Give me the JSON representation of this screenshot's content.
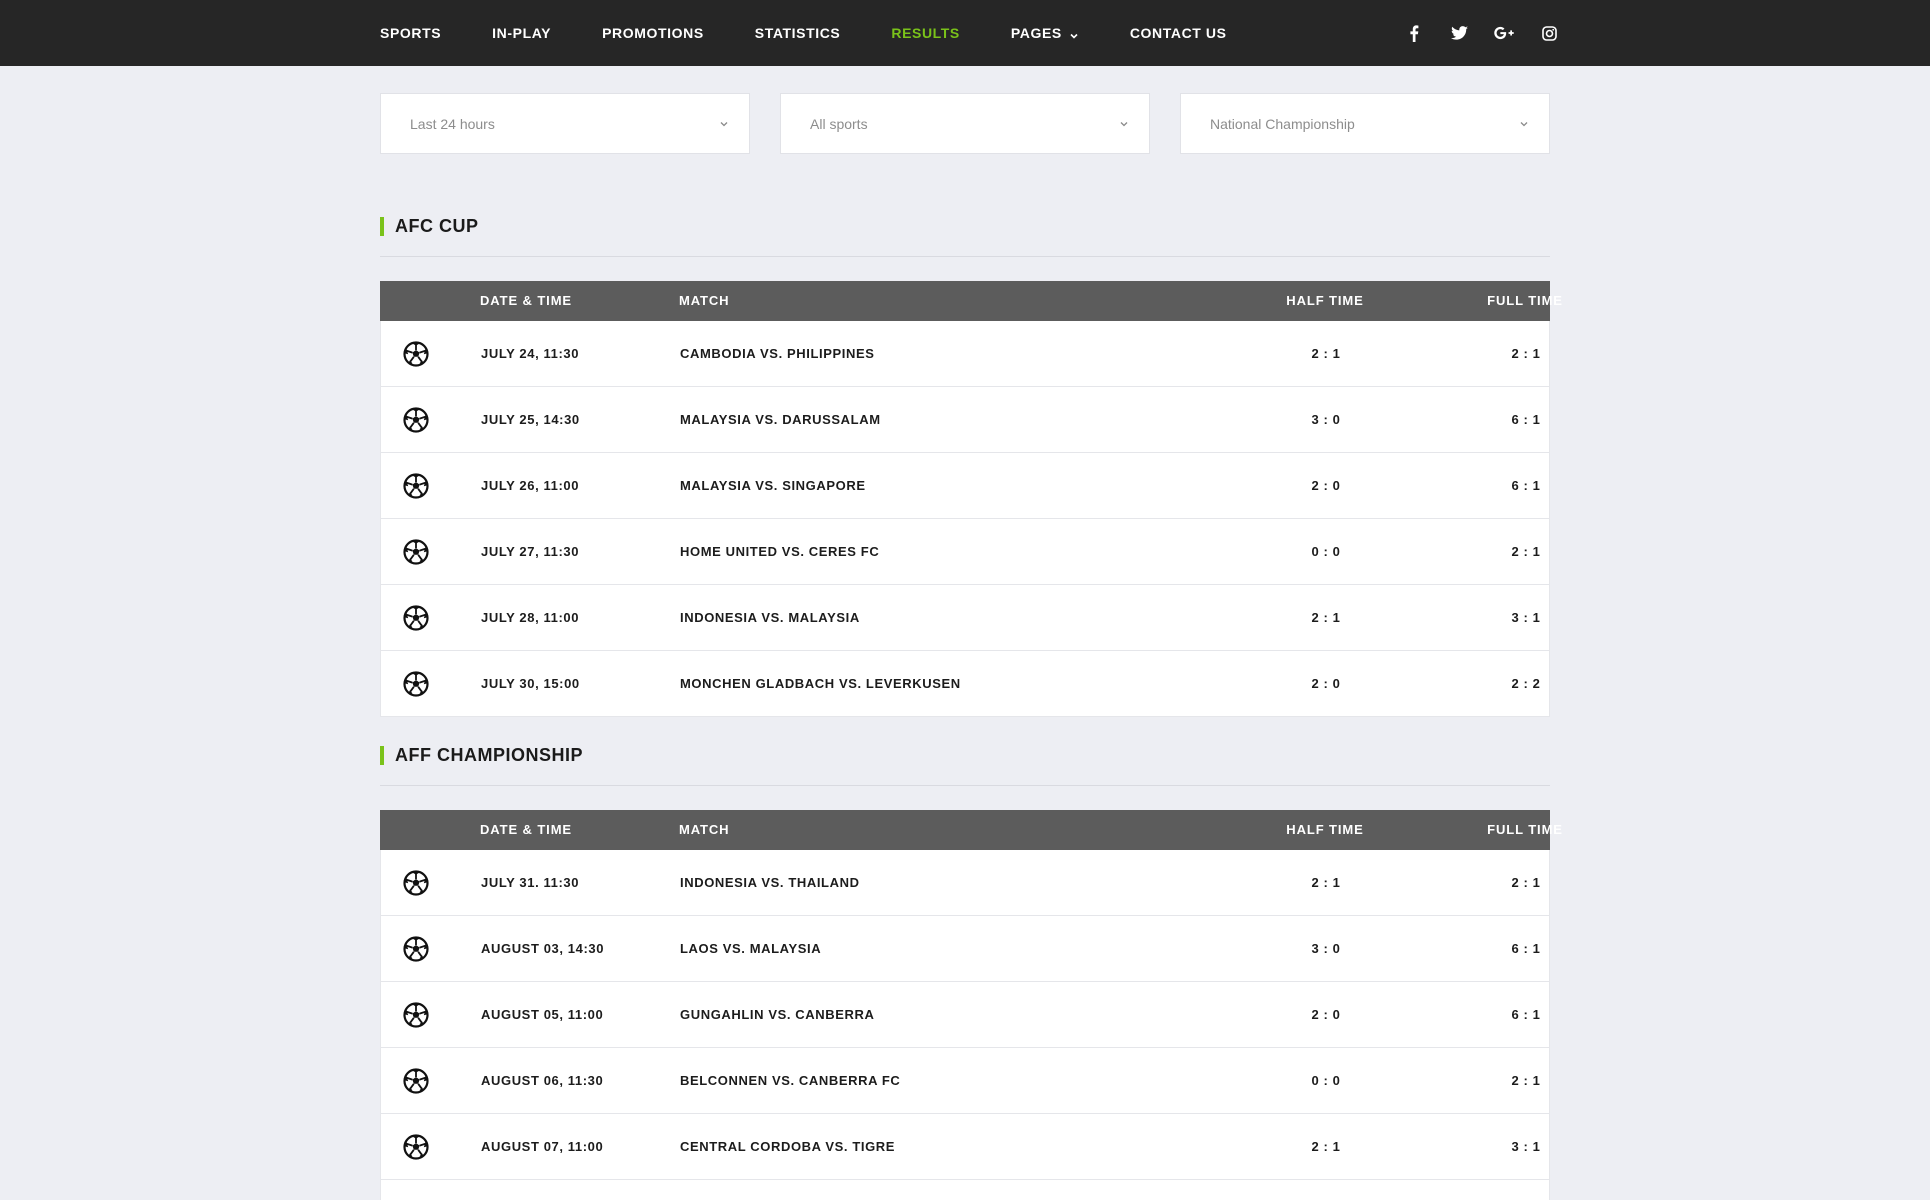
{
  "nav": {
    "items": [
      {
        "label": "SPORTS",
        "active": false
      },
      {
        "label": "IN-PLAY",
        "active": false
      },
      {
        "label": "PROMOTIONS",
        "active": false
      },
      {
        "label": "STATISTICS",
        "active": false
      },
      {
        "label": "RESULTS",
        "active": true
      },
      {
        "label": "PAGES",
        "active": false,
        "dropdown": true
      },
      {
        "label": "CONTACT US",
        "active": false
      }
    ],
    "social": [
      "facebook-icon",
      "twitter-icon",
      "google-plus-icon",
      "instagram-icon"
    ],
    "accent_color": "#7ac21a"
  },
  "filters": {
    "period": "Last 24 hours",
    "sport": "All sports",
    "championship": "National Championship"
  },
  "table_headers": {
    "date": "DATE & TIME",
    "match": "MATCH",
    "half": "HALF TIME",
    "full": "FULL TIME"
  },
  "sections": [
    {
      "title": "AFC CUP",
      "rows": [
        {
          "date": "JULY 24, 11:30",
          "match": "CAMBODIA VS. PHILIPPINES",
          "half": "2 : 1",
          "full": "2 : 1"
        },
        {
          "date": "JULY 25, 14:30",
          "match": "MALAYSIA VS. DARUSSALAM",
          "half": "3 : 0",
          "full": "6 : 1"
        },
        {
          "date": "JULY 26, 11:00",
          "match": "MALAYSIA VS. SINGAPORE",
          "half": "2 : 0",
          "full": "6 : 1"
        },
        {
          "date": "JULY 27, 11:30",
          "match": "HOME UNITED VS. CERES FC",
          "half": "0 : 0",
          "full": "2 : 1"
        },
        {
          "date": "JULY 28, 11:00",
          "match": "INDONESIA VS. MALAYSIA",
          "half": "2 : 1",
          "full": "3 : 1"
        },
        {
          "date": "JULY 30, 15:00",
          "match": "MONCHEN GLADBACH VS. LEVERKUSEN",
          "half": "2 : 0",
          "full": "2 : 2"
        }
      ]
    },
    {
      "title": "AFF CHAMPIONSHIP",
      "rows": [
        {
          "date": "JULY 31. 11:30",
          "match": "INDONESIA VS. THAILAND",
          "half": "2 : 1",
          "full": "2 : 1"
        },
        {
          "date": "AUGUST 03, 14:30",
          "match": "LAOS VS. MALAYSIA",
          "half": "3 : 0",
          "full": "6 : 1"
        },
        {
          "date": "AUGUST 05, 11:00",
          "match": "GUNGAHLIN VS. CANBERRA",
          "half": "2 : 0",
          "full": "6 : 1"
        },
        {
          "date": "AUGUST 06, 11:30",
          "match": "BELCONNEN VS. CANBERRA FC",
          "half": "0 : 0",
          "full": "2 : 1"
        },
        {
          "date": "AUGUST 07, 11:00",
          "match": "CENTRAL CORDOBA VS. TIGRE",
          "half": "2 : 1",
          "full": "3 : 1"
        },
        {
          "date": "",
          "match": "",
          "half": "",
          "full": ""
        }
      ]
    }
  ]
}
